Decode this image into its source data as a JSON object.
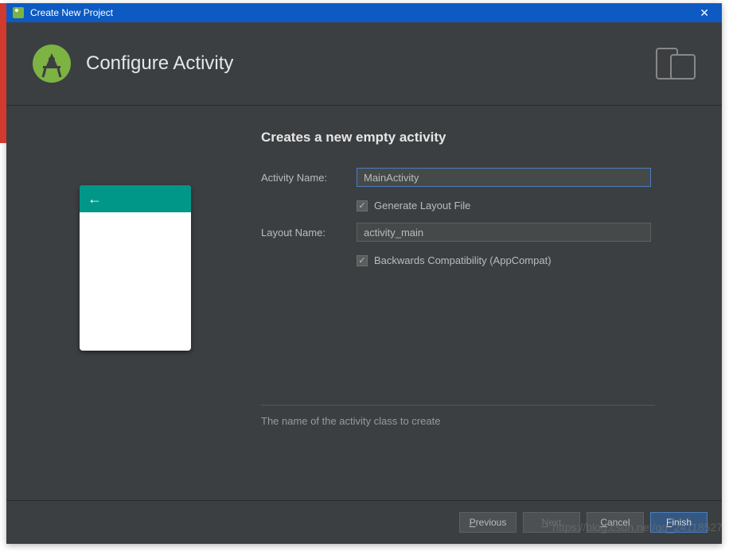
{
  "titlebar": {
    "title": "Create New Project"
  },
  "header": {
    "title": "Configure Activity"
  },
  "form": {
    "heading": "Creates a new empty activity",
    "activity_name_label": "Activity Name:",
    "activity_name_value": "MainActivity",
    "generate_layout_label": "Generate Layout File",
    "generate_layout_checked": true,
    "layout_name_label": "Layout Name:",
    "layout_name_value": "activity_main",
    "backwards_compat_label": "Backwards Compatibility (AppCompat)",
    "backwards_compat_checked": true,
    "help_text": "The name of the activity class to create"
  },
  "footer": {
    "previous_label": "Previous",
    "next_label": "Next",
    "cancel_label": "Cancel",
    "finish_label": "Finish"
  },
  "watermark": "https://blog.csdn.net/qq_24118527"
}
